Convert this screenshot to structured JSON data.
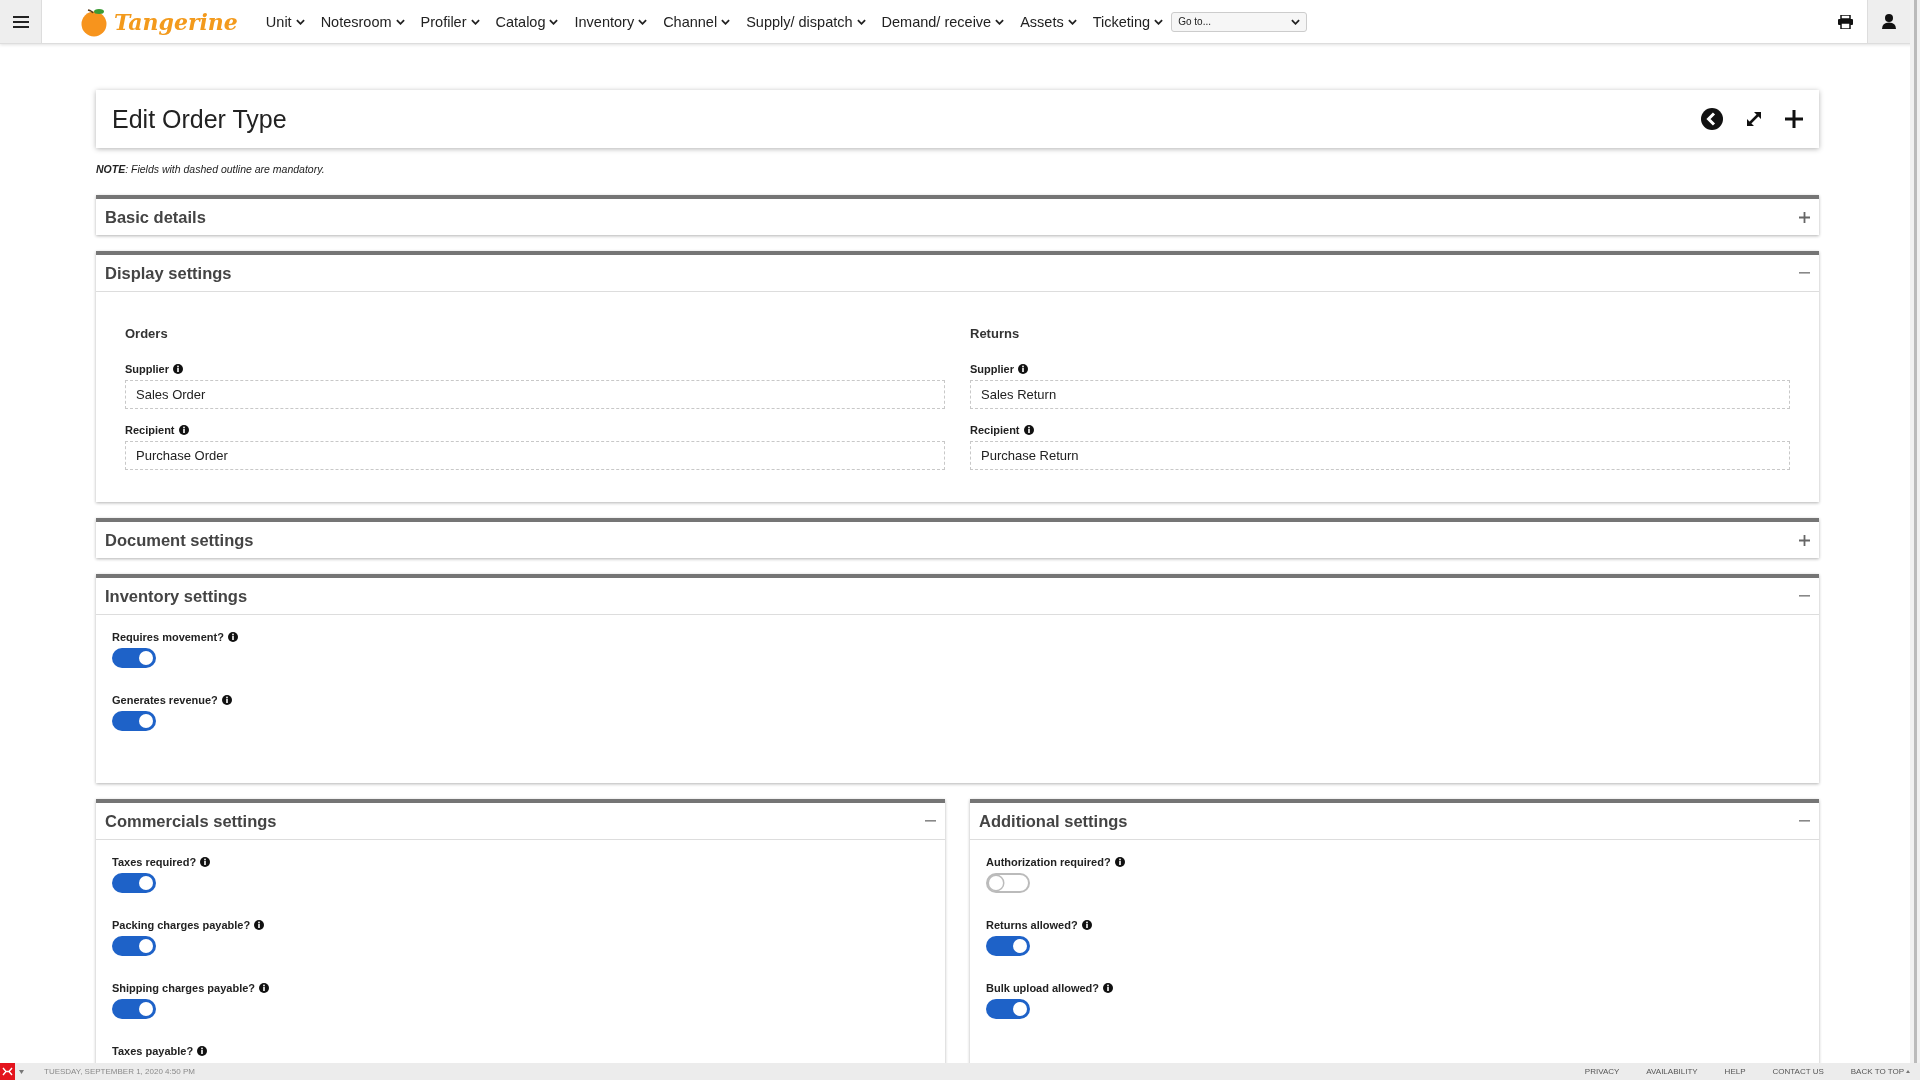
{
  "topbar": {
    "logo": "Tangerine",
    "menus": [
      "Unit",
      "Notesroom",
      "Profiler",
      "Catalog",
      "Inventory",
      "Channel",
      "Supply/ dispatch",
      "Demand/ receive",
      "Assets",
      "Ticketing"
    ],
    "goto": {
      "value": "Go to..."
    }
  },
  "header": {
    "title": "Edit Order Type"
  },
  "note": "**NOTE**: Fields with dashed outline are mandatory.",
  "rows": [
    [
      {
        "title": "Basic details",
        "expanded": false
      }
    ],
    [
      {
        "title": "Display settings",
        "expanded": true,
        "kind": "fields",
        "columns": [
          {
            "heading": "Orders",
            "fields": [
              {
                "label": "Supplier",
                "value": "Sales Order"
              },
              {
                "label": "Recipient",
                "value": "Purchase Order"
              }
            ]
          },
          {
            "heading": "Returns",
            "fields": [
              {
                "label": "Supplier",
                "value": "Sales Return"
              },
              {
                "label": "Recipient",
                "value": "Purchase Return"
              }
            ]
          }
        ]
      }
    ],
    [
      {
        "title": "Document settings",
        "expanded": false
      }
    ],
    [
      {
        "title": "Inventory settings",
        "expanded": true,
        "kind": "toggles",
        "toggles": [
          {
            "label": "Requires movement?",
            "on": true
          },
          {
            "label": "Generates revenue?",
            "on": true
          }
        ]
      }
    ],
    [
      {
        "title": "Commercials settings",
        "expanded": true,
        "kind": "toggles",
        "toggles": [
          {
            "label": "Taxes required?",
            "on": true
          },
          {
            "label": "Packing charges payable?",
            "on": true
          },
          {
            "label": "Shipping charges payable?",
            "on": true
          },
          {
            "label": "Taxes payable?"
          }
        ]
      },
      {
        "title": "Additional settings",
        "expanded": true,
        "kind": "toggles",
        "toggles": [
          {
            "label": "Authorization required?",
            "on": false
          },
          {
            "label": "Returns allowed?",
            "on": true
          },
          {
            "label": "Bulk upload allowed?",
            "on": true
          }
        ]
      }
    ]
  ],
  "footer": {
    "date": "TUESDAY, SEPTEMBER 1, 2020 4:50 PM",
    "links": [
      "PRIVACY",
      "AVAILABILITY",
      "HELP",
      "CONTACT US",
      "BACK TO TOP"
    ]
  }
}
